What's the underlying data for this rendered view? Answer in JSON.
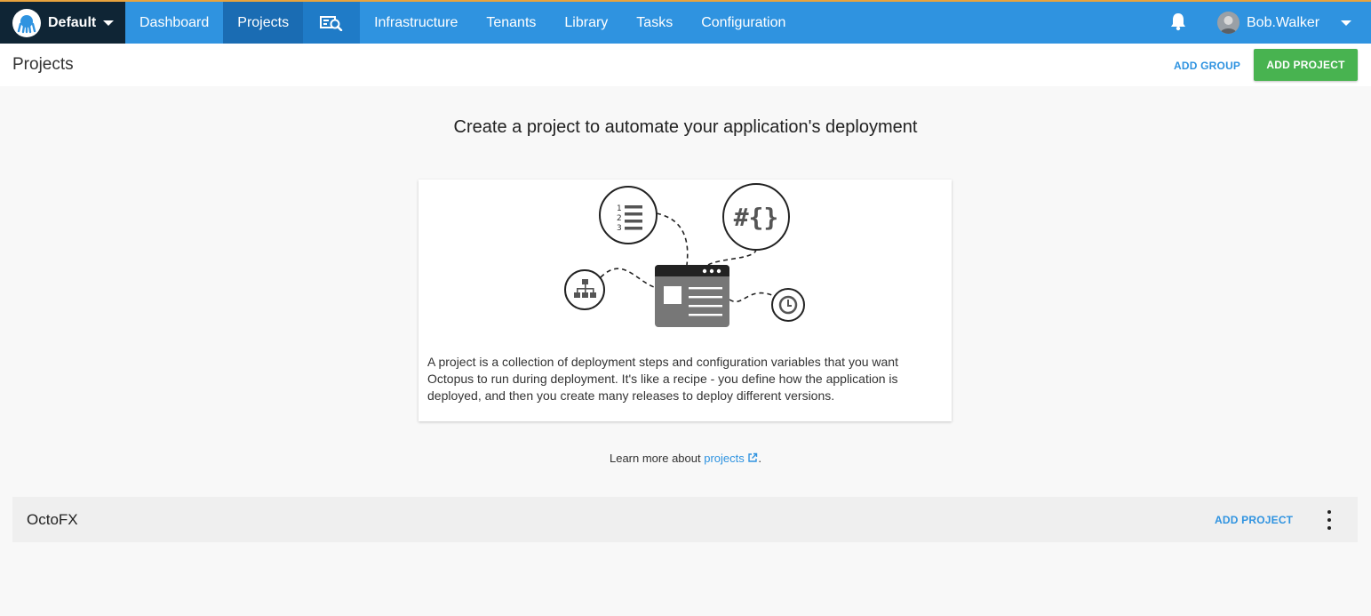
{
  "space": {
    "name": "Default"
  },
  "nav": {
    "items": [
      {
        "label": "Dashboard"
      },
      {
        "label": "Projects"
      },
      {
        "label": "Infrastructure"
      },
      {
        "label": "Tenants"
      },
      {
        "label": "Library"
      },
      {
        "label": "Tasks"
      },
      {
        "label": "Configuration"
      }
    ]
  },
  "user": {
    "name": "Bob.Walker"
  },
  "page": {
    "title": "Projects",
    "add_group_label": "ADD GROUP",
    "add_project_label": "ADD PROJECT"
  },
  "onboarding": {
    "title": "Create a project to automate your application's deployment",
    "description": "A project is a collection of deployment steps and configuration variables that you want Octopus to run during deployment. It's like a recipe - you define how the application is deployed, and then you create many releases to deploy different versions.",
    "learn_more_prefix": "Learn more about ",
    "learn_more_link": "projects",
    "learn_more_suffix": "."
  },
  "groups": [
    {
      "name": "OctoFX",
      "add_project_label": "ADD PROJECT"
    }
  ],
  "colors": {
    "nav_bg": "#2f93e0",
    "nav_active": "#1a6cb3",
    "space_bg": "#0f2535",
    "primary_button": "#48b350",
    "link": "#2f93e0"
  }
}
